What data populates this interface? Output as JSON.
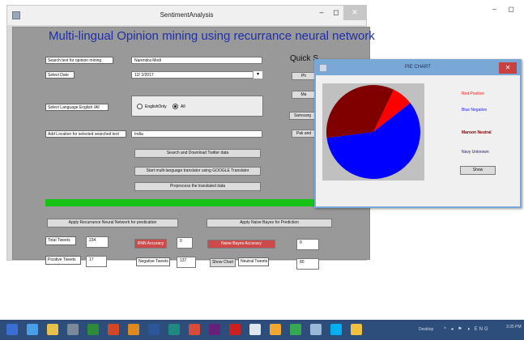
{
  "background_window": {
    "controls": "– ◻"
  },
  "main_window": {
    "title": "SentimentAnalysis",
    "controls": {
      "minimize": "–",
      "maximize": "◻",
      "close": "✕"
    },
    "heading": "Multi-lingual Opinion mining using recurrance neural network",
    "search_label": "Search text for opinion mining",
    "search_value": "Narendra Modi",
    "date_label": "Select Date",
    "date_value": "12/ 2/2017",
    "date_dropdown_icon": "▾",
    "quick_label": "Quick S",
    "quick_buttons": [
      "Ph",
      "Ma",
      "Samsung",
      "Pak and"
    ],
    "language_label": "Select Language English /All",
    "language_options": [
      {
        "label": "EnglishOnly",
        "selected": false
      },
      {
        "label": "All",
        "selected": true
      }
    ],
    "location_label": "Add Location for selected searched text",
    "location_value": "India",
    "btn_search_download": "Search and Download Twitter data",
    "btn_translate": "Start multi-language translator using GOOGLE Translator",
    "btn_preprocess": "Preprocess the translated data",
    "progress": 1.0,
    "btn_rnn": "Apply Recurrance Neural Network for predication",
    "btn_naive": "Apply Naive Bayes for Prediction",
    "total_tweets_label": "Total Tweets",
    "total_tweets_value": "234",
    "rnn_accuracy_label": "RNN Accuracy",
    "rnn_accuracy_value": "0",
    "naive_accuracy_label": "Naive Bayes Accuracy",
    "naive_accuracy_value": "0",
    "positive_label": "Positive Tweets",
    "positive_value": "17",
    "negative_label": "Negative Tweets",
    "negative_value": "137",
    "show_chart_label": "Show Chart",
    "neutral_label": "Neutral Tweets",
    "neutral_value": "80"
  },
  "pie_window": {
    "title": "PIE CHART",
    "close": "✕",
    "legend": [
      {
        "label": "Red Positive",
        "color": "#ff2020"
      },
      {
        "label": "Blue Negative",
        "color": "#2020ff"
      },
      {
        "label": "Maroon Neutral",
        "color": "#800000"
      },
      {
        "label": "Navy Unknown",
        "color": "#1a1a5a"
      }
    ],
    "show_button": "Show"
  },
  "chart_data": {
    "type": "pie",
    "title": "",
    "slices": [
      {
        "label": "Positive",
        "value": 17,
        "color": "#ff0000"
      },
      {
        "label": "Negative",
        "value": 137,
        "color": "#0000ff"
      },
      {
        "label": "Neutral",
        "value": 80,
        "color": "#800000"
      }
    ]
  },
  "taskbar": {
    "icons": [
      "start-icon",
      "ie-icon",
      "folder-icon",
      "paint-icon",
      "excel-icon",
      "powerpoint-icon",
      "media-icon",
      "word-icon",
      "publisher-icon",
      "chrome-icon",
      "visual-studio-icon",
      "opera-icon",
      "file-icon",
      "user-icon",
      "app-icon",
      "network-icon",
      "skype-icon",
      "explorer-icon"
    ],
    "icon_colors": [
      "#3a6fd1",
      "#4aa0e6",
      "#e6c04a",
      "#7a8a9a",
      "#2e8b3a",
      "#d24726",
      "#e08a1e",
      "#2b579a",
      "#1e8a80",
      "#d84a3a",
      "#68217a",
      "#cc1f1f",
      "#dfe6f0",
      "#f2a72e",
      "#36a852",
      "#9ab8d8",
      "#00aff0",
      "#f0c040"
    ],
    "desktop_label": "Desktop",
    "tray": "^ ◂ ⚑ 🕨 ENG",
    "clock": "3:35 PM"
  }
}
